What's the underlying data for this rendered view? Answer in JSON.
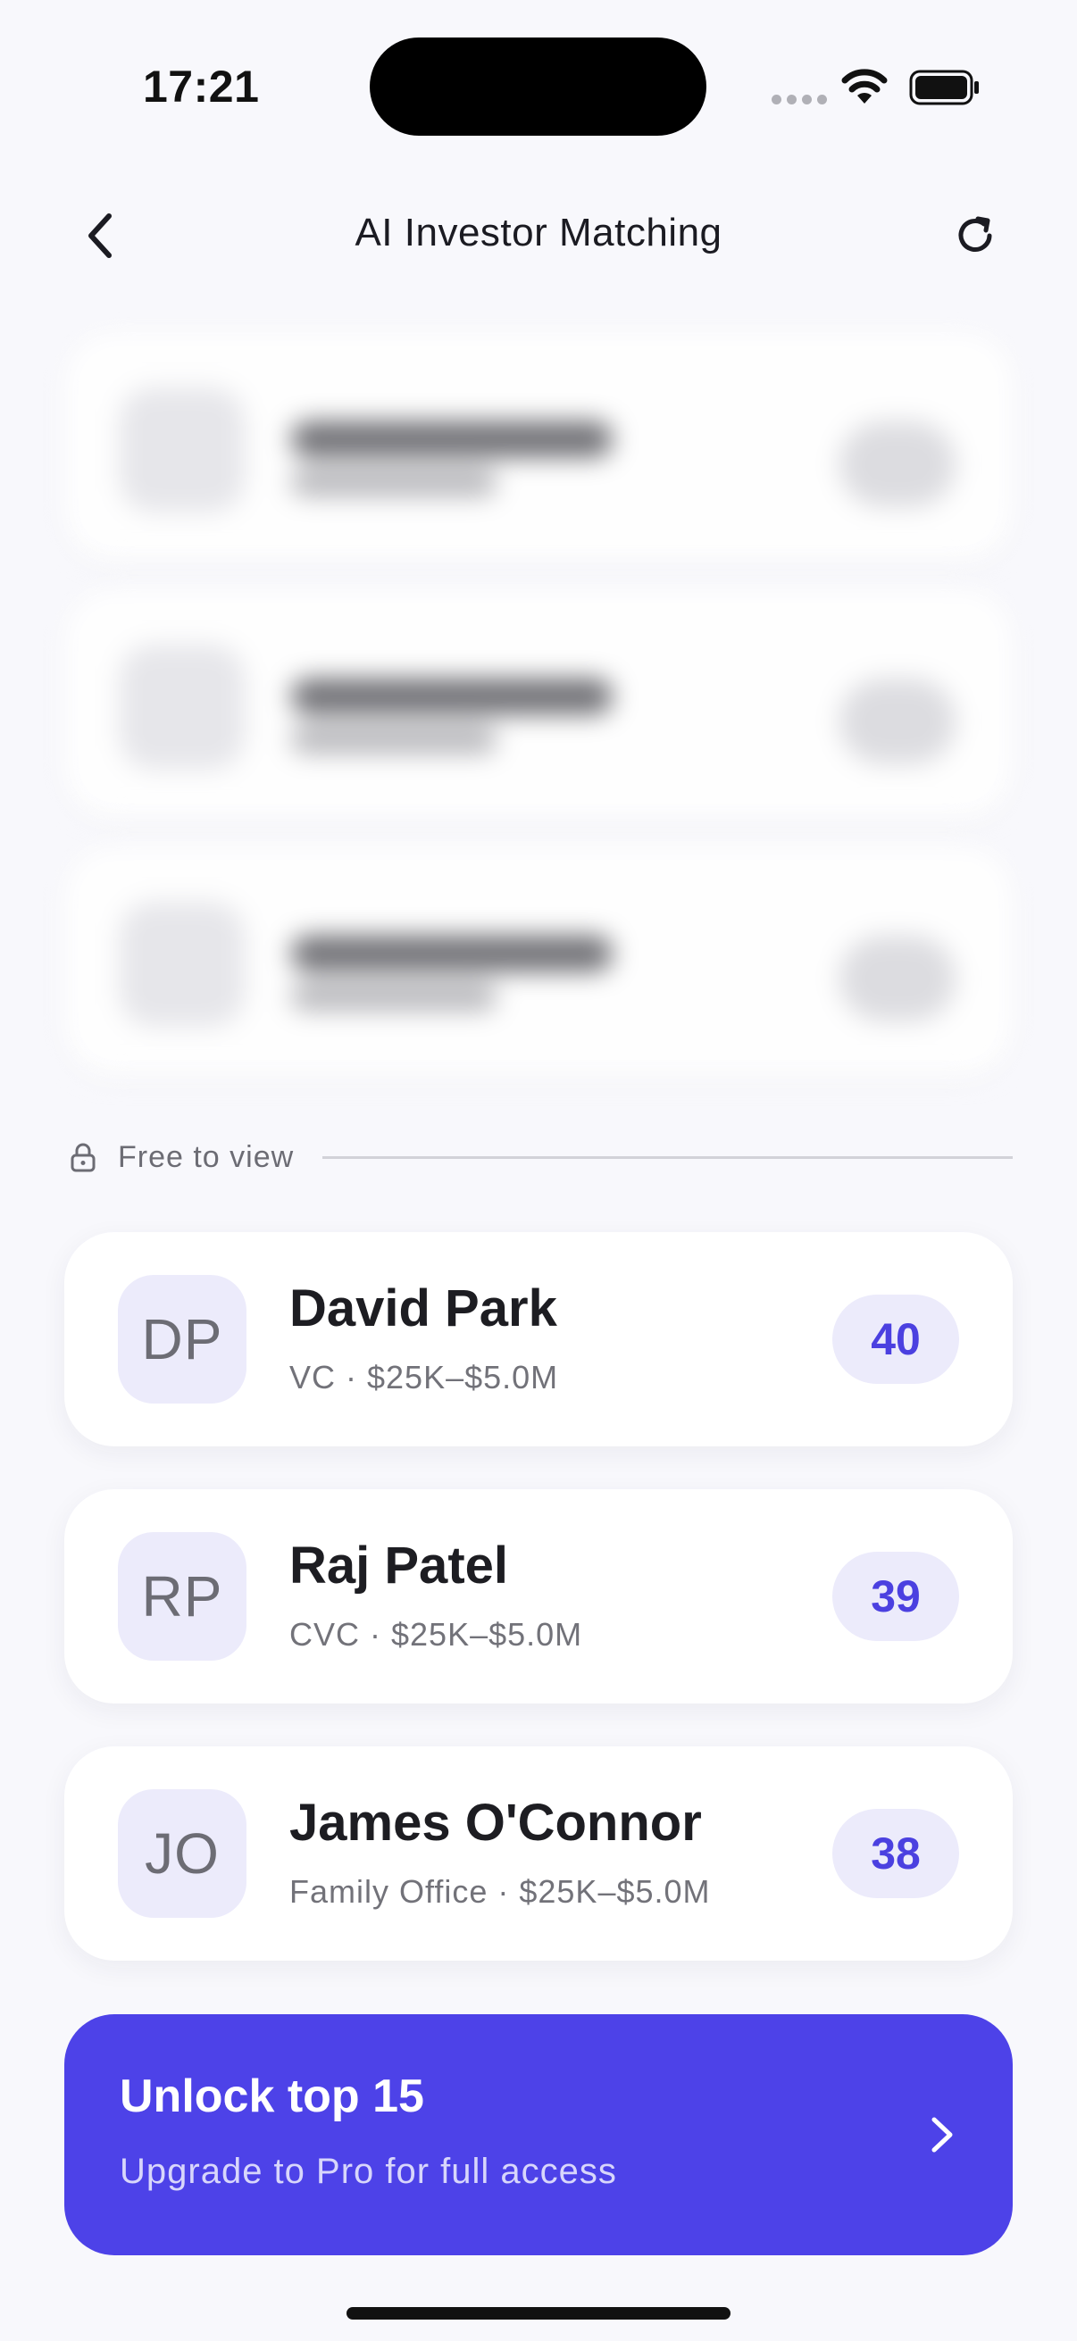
{
  "status_bar": {
    "time": "17:21"
  },
  "nav": {
    "title": "AI Investor Matching",
    "back_icon": "chevron-left-icon",
    "refresh_icon": "refresh-icon"
  },
  "divider": {
    "label": "Free to view",
    "icon": "lock-icon"
  },
  "investors": [
    {
      "initials": "DP",
      "name": "David Park",
      "meta": "VC · $25K–$5.0M",
      "score": "40"
    },
    {
      "initials": "RP",
      "name": "Raj Patel",
      "meta": "CVC · $25K–$5.0M",
      "score": "39"
    },
    {
      "initials": "JO",
      "name": "James O'Connor",
      "meta": "Family Office · $25K–$5.0M",
      "score": "38"
    }
  ],
  "cta": {
    "title": "Unlock top 15",
    "subtitle": "Upgrade to Pro for full access",
    "icon": "chevron-right-icon"
  },
  "colors": {
    "accent": "#4d42e8",
    "score_text": "#4b40e0",
    "score_bg": "#ecebfb",
    "background": "#f8f8fc"
  }
}
